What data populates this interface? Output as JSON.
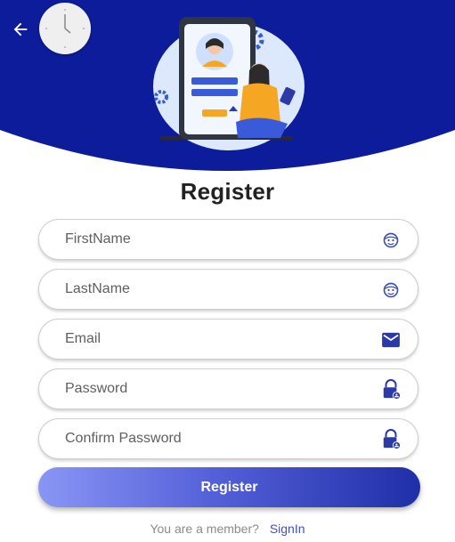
{
  "header": {
    "back_icon": "arrow-left-icon",
    "clock_icon": "clock-icon",
    "illustration": "registration-illustration",
    "brand_color": "#0d1c9a"
  },
  "form": {
    "title": "Register",
    "fields": [
      {
        "placeholder": "FirstName",
        "value": "",
        "icon": "face-icon"
      },
      {
        "placeholder": "LastName",
        "value": "",
        "icon": "face-icon"
      },
      {
        "placeholder": "Email",
        "value": "",
        "icon": "mail-icon"
      },
      {
        "placeholder": "Password",
        "value": "",
        "icon": "lock-icon"
      },
      {
        "placeholder": "Confirm Password",
        "value": "",
        "icon": "lock-icon"
      }
    ],
    "submit_label": "Register"
  },
  "footer": {
    "prompt": "You are a member?",
    "link_label": "SignIn"
  }
}
